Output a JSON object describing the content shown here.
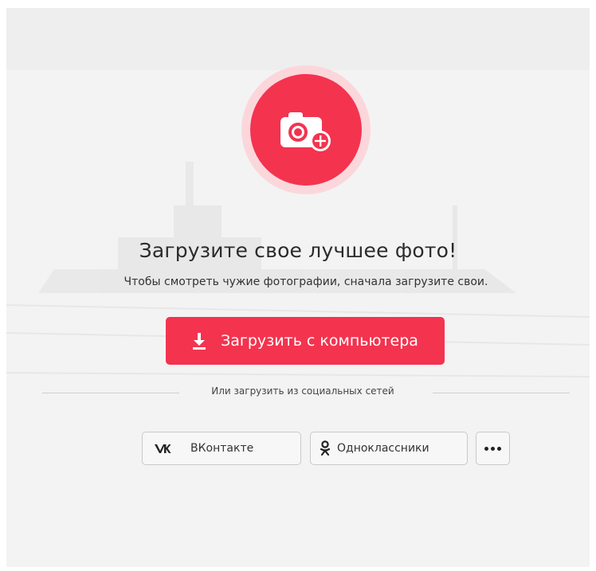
{
  "upload": {
    "headline": "Загрузите свое лучшее фото!",
    "subline": "Чтобы смотреть чужие фотографии, сначала загрузите свои.",
    "button_label": "Загрузить с компьютера",
    "camera_icon": "camera-plus-icon",
    "download_icon": "download-icon"
  },
  "social": {
    "divider_text": "Или загрузить из социальных сетей",
    "vk_label": "ВКонтакте",
    "vk_icon": "vk-icon",
    "ok_label": "Одноклассники",
    "ok_icon": "odnoklassniki-icon",
    "more_icon": "more-dots-icon"
  },
  "colors": {
    "accent": "#f4334f",
    "accent_halo": "#fbd7dc",
    "background": "#f3f3f3"
  }
}
